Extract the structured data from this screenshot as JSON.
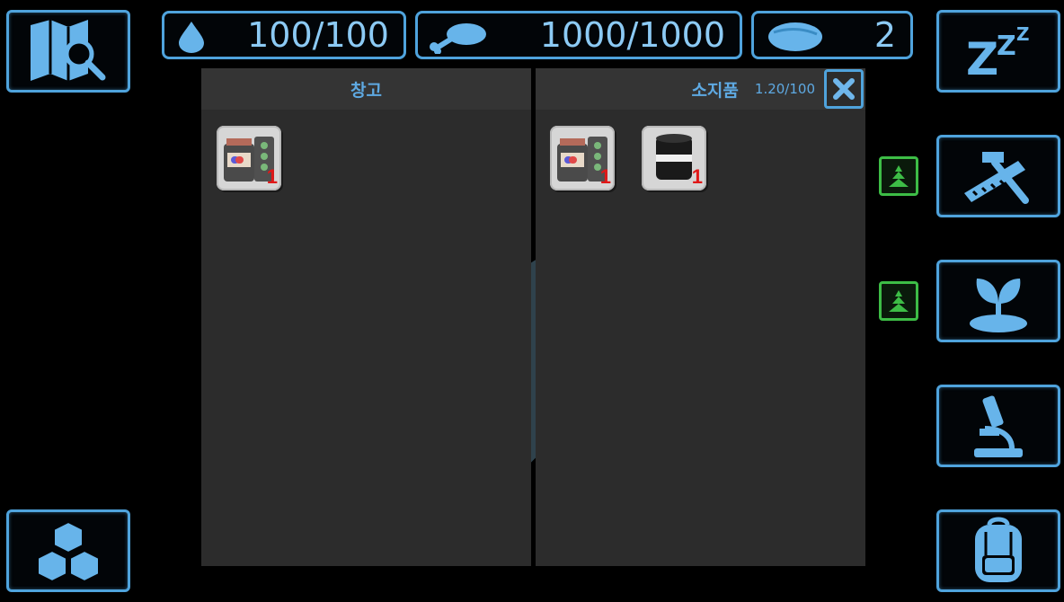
{
  "stats": {
    "water": "100/100",
    "food": "1000/1000",
    "special": "2"
  },
  "storage_panel": {
    "title": "창고",
    "items": [
      {
        "icon": "pill-jar-icon",
        "qty": "1"
      }
    ]
  },
  "inventory_panel": {
    "title": "소지품",
    "weight": "1.20/100",
    "items": [
      {
        "icon": "pill-jar-icon",
        "qty": "1"
      },
      {
        "icon": "oil-barrel-icon",
        "qty": "1"
      }
    ]
  },
  "colors": {
    "accent": "#4fa3dc",
    "panel": "#2c2c2c",
    "upgrade": "#3dbd46",
    "qty": "#e01818"
  }
}
